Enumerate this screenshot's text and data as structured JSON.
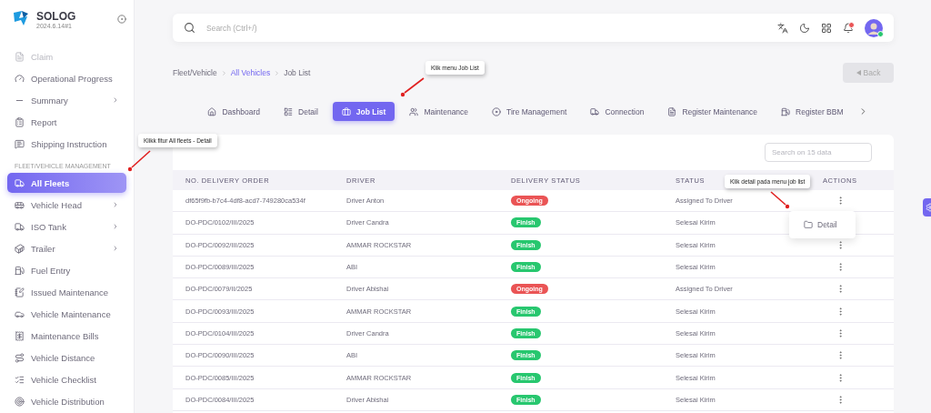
{
  "brand": {
    "name": "SOLOG",
    "version": "2024.6.14#1"
  },
  "sidebar": {
    "section_label": "FLEET/VEHICLE MANAGEMENT",
    "items_top": [
      {
        "label": "Claim",
        "disabled": true,
        "expandable": false,
        "selected": false
      },
      {
        "label": "Operational Progress",
        "disabled": false,
        "expandable": false,
        "selected": false
      },
      {
        "label": "Summary",
        "disabled": false,
        "expandable": true,
        "selected": false
      },
      {
        "label": "Report",
        "disabled": false,
        "expandable": false,
        "selected": false
      },
      {
        "label": "Shipping Instruction",
        "disabled": false,
        "expandable": false,
        "selected": false
      }
    ],
    "items": [
      {
        "label": "All Fleets",
        "disabled": false,
        "expandable": false,
        "selected": true
      },
      {
        "label": "Vehicle Head",
        "disabled": false,
        "expandable": true,
        "selected": false
      },
      {
        "label": "ISO Tank",
        "disabled": false,
        "expandable": true,
        "selected": false
      },
      {
        "label": "Trailer",
        "disabled": false,
        "expandable": true,
        "selected": false
      },
      {
        "label": "Fuel Entry",
        "disabled": false,
        "expandable": false,
        "selected": false
      },
      {
        "label": "Issued Maintenance",
        "disabled": false,
        "expandable": false,
        "selected": false
      },
      {
        "label": "Vehicle Maintenance",
        "disabled": false,
        "expandable": false,
        "selected": false
      },
      {
        "label": "Maintenance Bills",
        "disabled": false,
        "expandable": false,
        "selected": false
      },
      {
        "label": "Vehicle Distance",
        "disabled": false,
        "expandable": false,
        "selected": false
      },
      {
        "label": "Vehicle Checklist",
        "disabled": false,
        "expandable": false,
        "selected": false
      },
      {
        "label": "Vehicle Distribution",
        "disabled": false,
        "expandable": false,
        "selected": false
      }
    ]
  },
  "header": {
    "search_placeholder": "Search (Ctrl+/)",
    "notification_unread": true,
    "avatar_online": true
  },
  "breadcrumb": [
    {
      "label": "Fleet/Vehicle",
      "link": false
    },
    {
      "label": "All Vehicles",
      "link": true
    },
    {
      "label": "Job List",
      "link": false
    }
  ],
  "back_button": {
    "label": "Back",
    "disabled": true
  },
  "tabs": [
    {
      "label": "Dashboard",
      "selected": false
    },
    {
      "label": "Detail",
      "selected": false
    },
    {
      "label": "Job List",
      "selected": true
    },
    {
      "label": "Maintenance",
      "selected": false
    },
    {
      "label": "Tire Management",
      "selected": false
    },
    {
      "label": "Connection",
      "selected": false
    },
    {
      "label": "Register Maintenance",
      "selected": false
    },
    {
      "label": "Register BBM",
      "selected": false
    }
  ],
  "table": {
    "search_placeholder": "Search on 15 data",
    "columns": [
      "NO. DELIVERY ORDER",
      "DRIVER",
      "DELIVERY STATUS",
      "STATUS",
      "ACTIONS"
    ],
    "rows": [
      {
        "order": "df65f9fb-b7c4-4df8-acd7-749280ca534f",
        "driver": "Driver Anton",
        "delivery_status": "Ongoing",
        "color": "#ea5455",
        "status": "Assigned To Driver"
      },
      {
        "order": "DO-PDC/0102/III/2025",
        "driver": "Driver Candra",
        "delivery_status": "Finish",
        "color": "#28c76f",
        "status": "Selesai Kirim"
      },
      {
        "order": "DO-PDC/0092/III/2025",
        "driver": "AMMAR ROCKSTAR",
        "delivery_status": "Finish",
        "color": "#28c76f",
        "status": "Selesai Kirim"
      },
      {
        "order": "DO-PDC/0089/III/2025",
        "driver": "ABI",
        "delivery_status": "Finish",
        "color": "#28c76f",
        "status": "Selesai Kirim"
      },
      {
        "order": "DO-PDC/0079/II/2025",
        "driver": "Driver Abishai",
        "delivery_status": "Ongoing",
        "color": "#ea5455",
        "status": "Assigned To Driver"
      },
      {
        "order": "DO-PDC/0093/III/2025",
        "driver": "AMMAR ROCKSTAR",
        "delivery_status": "Finish",
        "color": "#28c76f",
        "status": "Selesai Kirim"
      },
      {
        "order": "DO-PDC/0104/III/2025",
        "driver": "Driver Candra",
        "delivery_status": "Finish",
        "color": "#28c76f",
        "status": "Selesai Kirim"
      },
      {
        "order": "DO-PDC/0090/III/2025",
        "driver": "ABI",
        "delivery_status": "Finish",
        "color": "#28c76f",
        "status": "Selesai Kirim"
      },
      {
        "order": "DO-PDC/0085/III/2025",
        "driver": "AMMAR ROCKSTAR",
        "delivery_status": "Finish",
        "color": "#28c76f",
        "status": "Selesai Kirim"
      },
      {
        "order": "DO-PDC/0084/III/2025",
        "driver": "Driver Abishai",
        "delivery_status": "Finish",
        "color": "#28c76f",
        "status": "Selesai Kirim"
      }
    ]
  },
  "action_menu": {
    "items": [
      {
        "label": "Detail"
      }
    ]
  },
  "annotations": [
    {
      "kind": "tabs",
      "text": "Klik menu Job List"
    },
    {
      "kind": "sidebar",
      "text": "Klikk fitur All fleets - Detail"
    },
    {
      "kind": "actions",
      "text": "Klik detail pada menu job list"
    }
  ]
}
